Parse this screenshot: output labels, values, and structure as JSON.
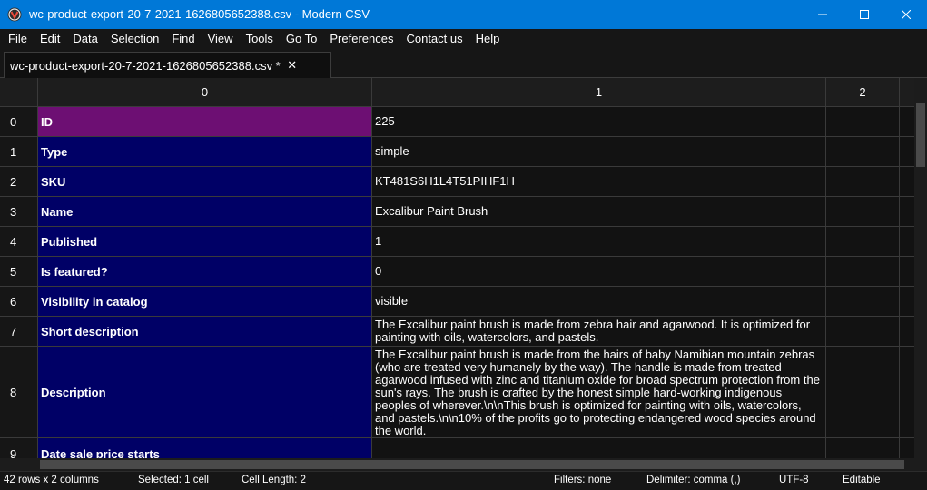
{
  "window": {
    "title": "wc-product-export-20-7-2021-1626805652388.csv - Modern CSV",
    "accent_color": "#0078d7",
    "controls": [
      "minimize-icon",
      "maximize-icon",
      "close-icon"
    ]
  },
  "menu": [
    "File",
    "Edit",
    "Data",
    "Selection",
    "Find",
    "View",
    "Tools",
    "Go To",
    "Preferences",
    "Contact us",
    "Help"
  ],
  "tab": {
    "label": "wc-product-export-20-7-2021-1626805652388.csv *",
    "close_symbol": "✕"
  },
  "columns": [
    "0",
    "1",
    "2"
  ],
  "rows": [
    {
      "num": "0",
      "key": "ID",
      "value": "225",
      "selected": true
    },
    {
      "num": "1",
      "key": "Type",
      "value": "simple"
    },
    {
      "num": "2",
      "key": "SKU",
      "value": "KT481S6H1L4T51PIHF1H"
    },
    {
      "num": "3",
      "key": "Name",
      "value": "Excalibur Paint Brush"
    },
    {
      "num": "4",
      "key": "Published",
      "value": "1"
    },
    {
      "num": "5",
      "key": "Is featured?",
      "value": "0"
    },
    {
      "num": "6",
      "key": "Visibility in catalog",
      "value": "visible"
    },
    {
      "num": "7",
      "key": "Short description",
      "value": "The Excalibur paint brush is made from zebra hair and agarwood. It is optimized for painting with oils, watercolors, and pastels."
    },
    {
      "num": "8",
      "key": "Description",
      "value": "The Excalibur paint brush is made from the hairs of baby Namibian mountain zebras (who are treated very humanely by the way). The handle is made from treated agarwood infused with zinc and titanium oxide for broad spectrum protection from the sun's rays. The brush is crafted by the honest simple hard-working indigenous peoples of wherever.\\n\\nThis brush is optimized for painting with oils, watercolors, and pastels.\\n\\n10% of the profits go to protecting endangered wood species around the world."
    },
    {
      "num": "9",
      "key": "Date sale price starts",
      "value": ""
    }
  ],
  "colors": {
    "key_cell": "#000066",
    "selected_cell": "#6d0f73",
    "grid_bg": "#121212"
  },
  "status": {
    "rows_cols": "42 rows x 2 columns",
    "selected": "Selected: 1 cell",
    "cell_length": "Cell Length: 2",
    "filters": "Filters: none",
    "delimiter": "Delimiter: comma (,)",
    "encoding": "UTF-8",
    "mode": "Editable"
  }
}
